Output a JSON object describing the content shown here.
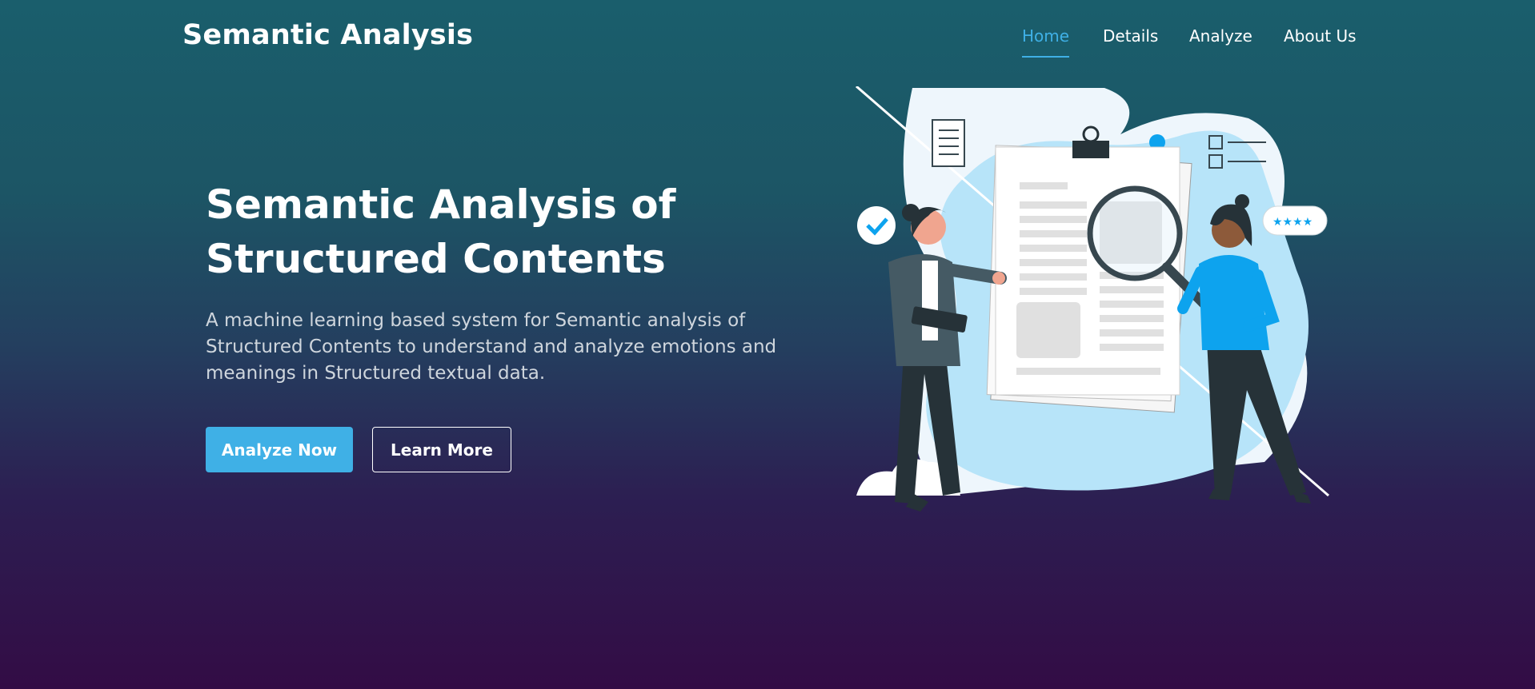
{
  "navbar": {
    "brand": "Semantic Analysis",
    "items": [
      {
        "label": "Home",
        "active": true
      },
      {
        "label": "Details",
        "active": false
      },
      {
        "label": "Analyze",
        "active": false
      },
      {
        "label": "About Us",
        "active": false
      }
    ]
  },
  "hero": {
    "title_line1": "Semantic Analysis of",
    "title_line2": "Structured Contents",
    "description": "A machine learning based system for Semantic analysis of Structured Contents to understand and analyze emotions and meanings in Structured textual data.",
    "primary_button": "Analyze Now",
    "secondary_button": "Learn More",
    "illustration": "people-analyzing-document-illustration"
  },
  "colors": {
    "accent": "#3fb0e6",
    "gradient_top": "#1a5e6c",
    "gradient_bottom": "#330c45",
    "blob": "#b7e4f9",
    "person_shirt": "#0da3ee"
  }
}
